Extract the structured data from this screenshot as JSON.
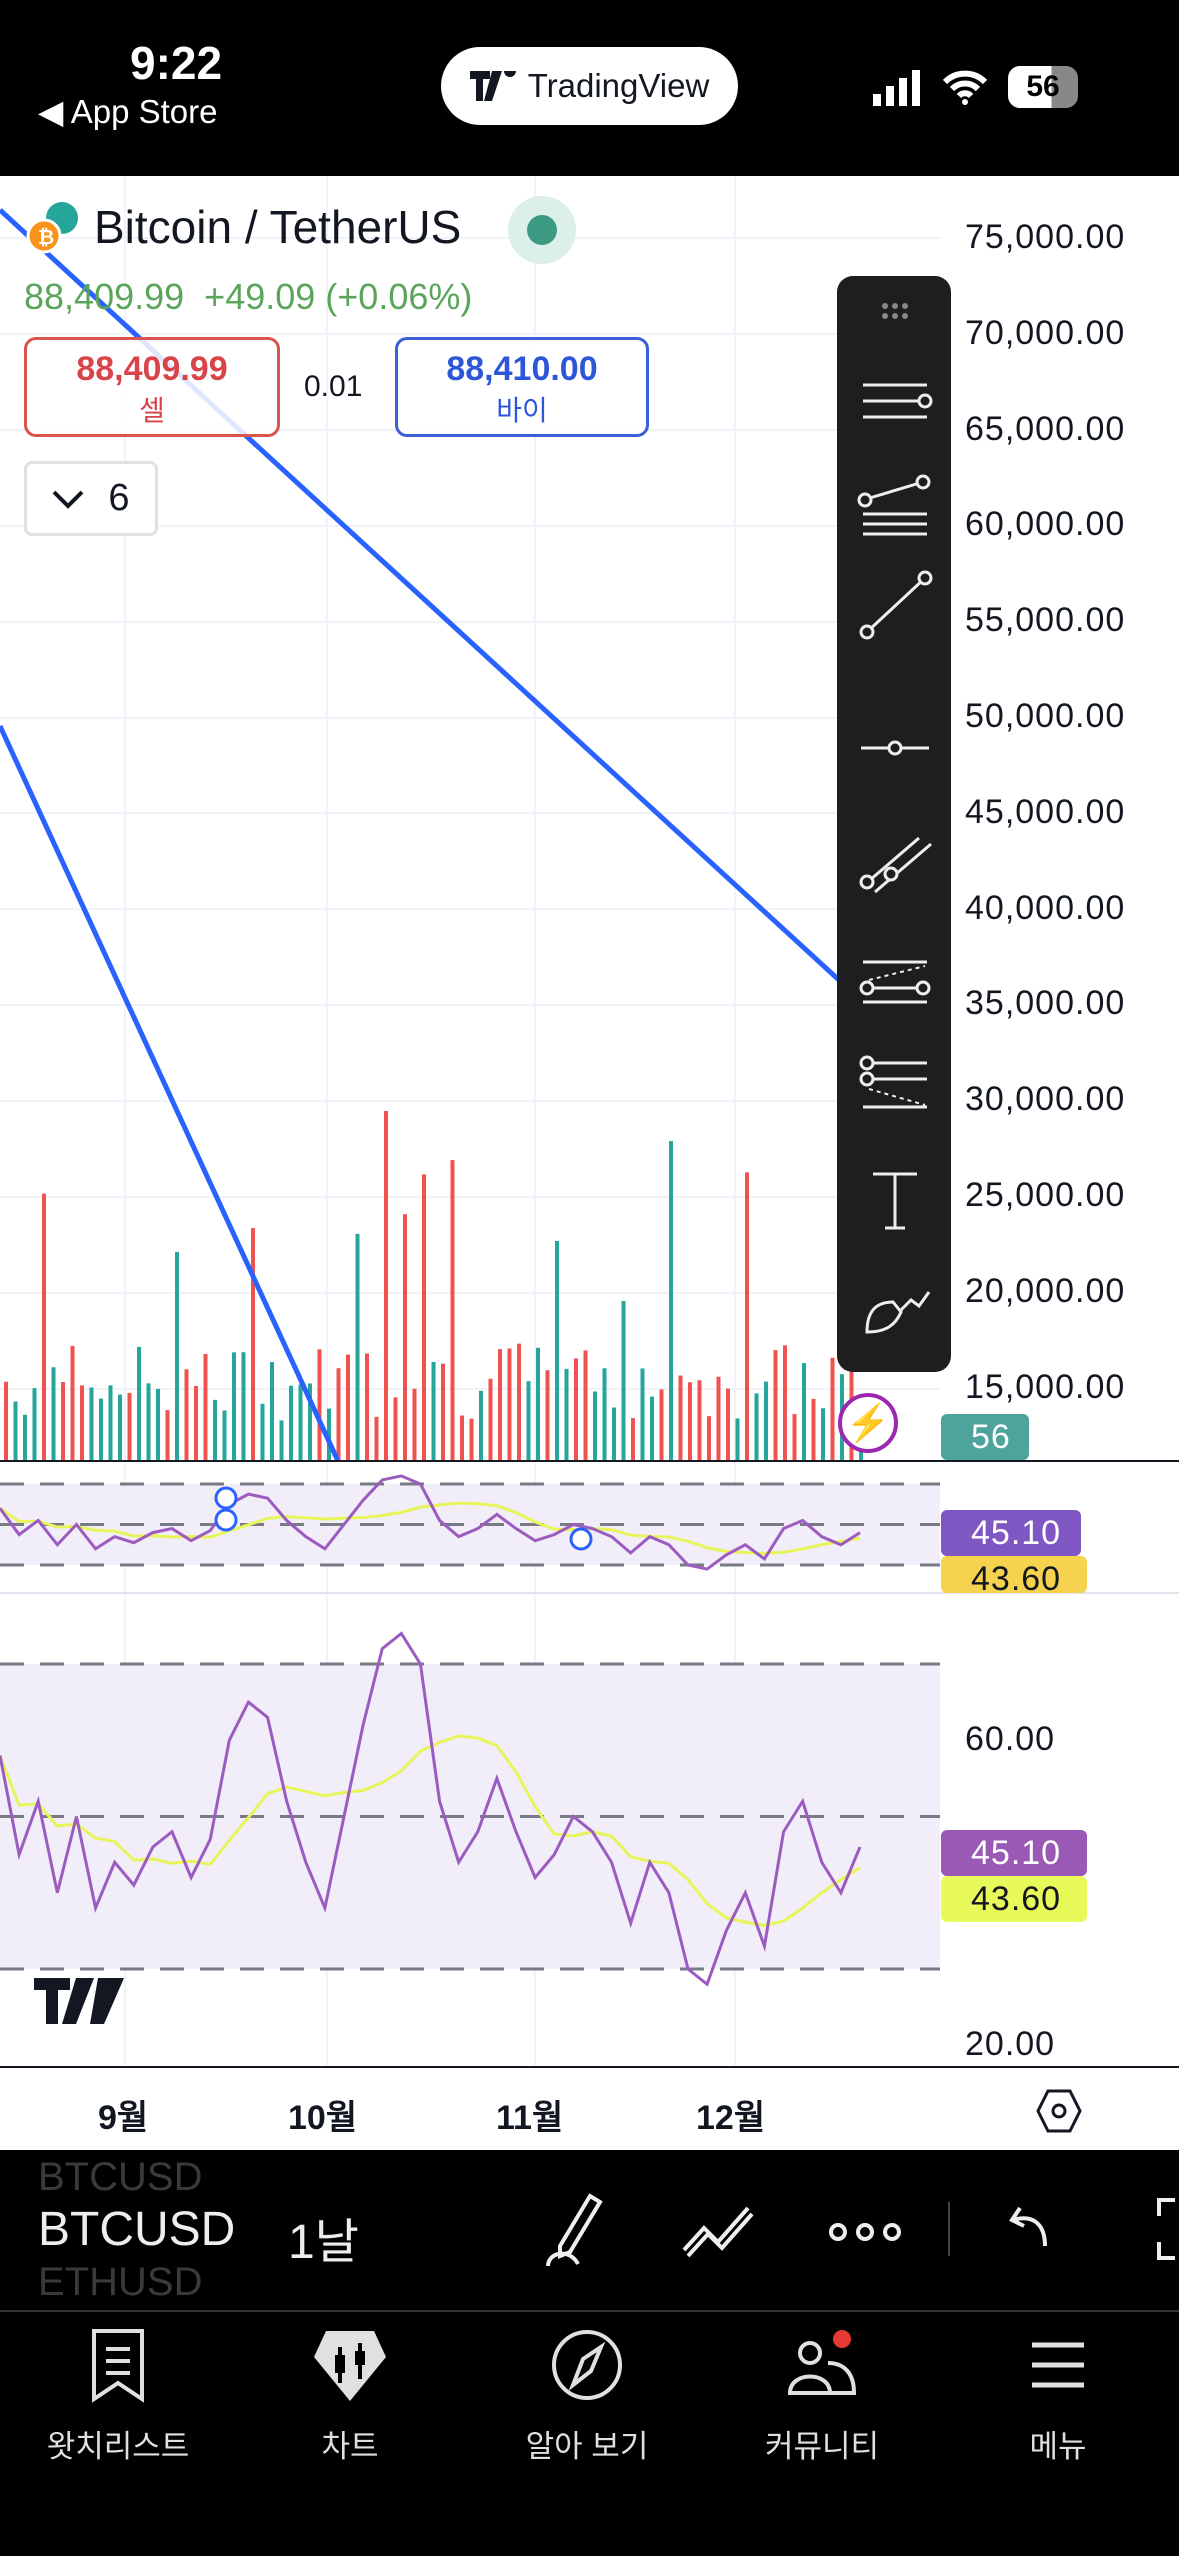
{
  "status_bar": {
    "time": "9:22",
    "back_label": "App Store",
    "app_pill": "TradingView",
    "battery": "56"
  },
  "symbol": {
    "title": "Bitcoin / TetherUS",
    "last": "88,409.99",
    "change": "+49.09 (+0.06%)",
    "sell_price": "88,409.99",
    "sell_label": "셀",
    "spread": "0.01",
    "buy_price": "88,410.00",
    "buy_label": "바이",
    "indicators_count": "6"
  },
  "price_axis": [
    "75,000.00",
    "70,000.00",
    "65,000.00",
    "60,000.00",
    "55,000.00",
    "50,000.00",
    "45,000.00",
    "40,000.00",
    "35,000.00",
    "30,000.00",
    "25,000.00",
    "20,000.00",
    "15,000.00"
  ],
  "volume_badge": "56",
  "rsi": {
    "value": "45.10",
    "ma": "43.60",
    "axis": [
      "60.00",
      "20.00"
    ],
    "levels": [
      70,
      50,
      30
    ],
    "series": [
      58,
      45,
      52,
      40,
      50,
      38,
      44,
      41,
      46,
      48,
      42,
      47,
      60,
      65,
      63,
      52,
      44,
      38,
      50,
      62,
      72,
      74,
      70,
      52,
      44,
      48,
      55,
      48,
      42,
      45,
      50,
      48,
      44,
      36,
      44,
      40,
      30,
      28,
      35,
      40,
      33,
      48,
      52,
      44,
      40,
      46
    ]
  },
  "time_axis": [
    "9월",
    "10월",
    "11월",
    "12월"
  ],
  "bottom_toolbar": {
    "symbol": "BTCUSD",
    "symbol_prev": "BTCUSD",
    "symbol_next": "ETHUSD",
    "interval": "1날"
  },
  "tabs": [
    {
      "label": "왓치리스트",
      "icon": "watchlist-icon"
    },
    {
      "label": "차트",
      "icon": "chart-icon"
    },
    {
      "label": "알아 보기",
      "icon": "compass-icon"
    },
    {
      "label": "커뮤니티",
      "icon": "community-icon"
    },
    {
      "label": "메뉴",
      "icon": "menu-icon"
    }
  ],
  "colors": {
    "up": "#26a69a",
    "down": "#ef5350",
    "line": "#2962ff",
    "rsi": "#9c5cbf",
    "rsi_ma": "#e8f55a",
    "change": "#5ba55b"
  }
}
